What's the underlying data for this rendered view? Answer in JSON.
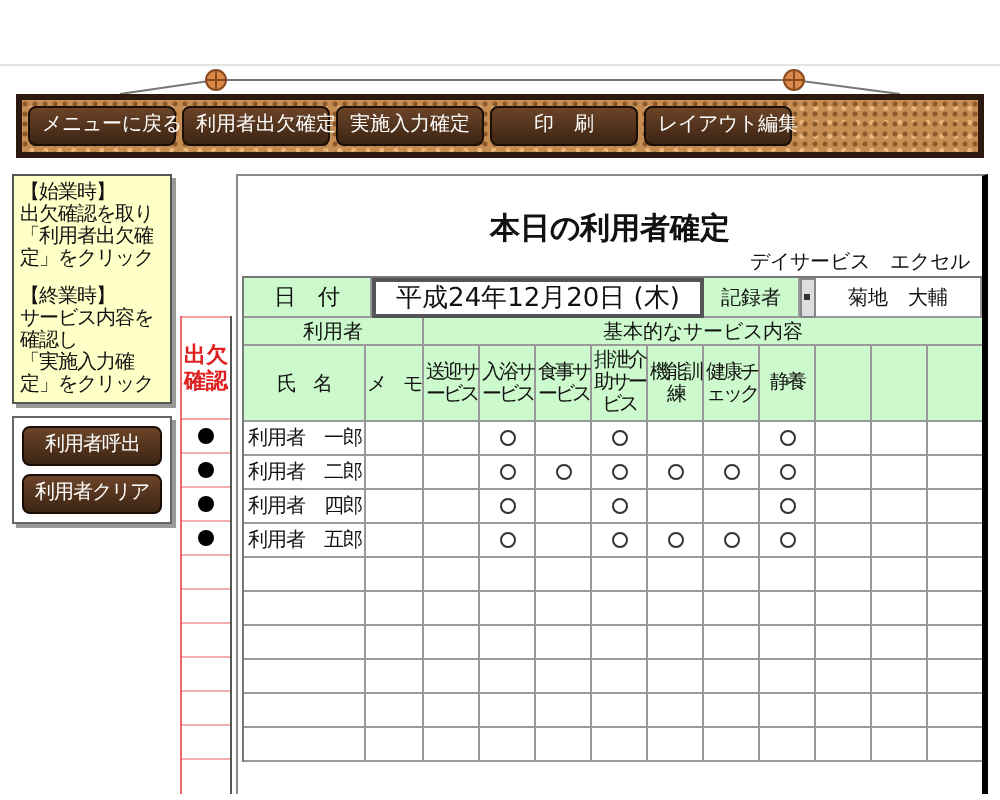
{
  "toolbar": {
    "buttons": [
      "メニューに戻る",
      "利用者出欠確定",
      "実施入力確定",
      "印　刷",
      "レイアウト編集"
    ]
  },
  "notes": [
    {
      "heading": "【始業時】",
      "lines": [
        "出欠確認を取り",
        "「利用者出欠確定」をクリック"
      ]
    },
    {
      "heading": "【終業時】",
      "lines": [
        "サービス内容を確認し",
        "「実施入力確定」をクリック"
      ]
    }
  ],
  "actions": [
    "利用者呼出",
    "利用者クリア"
  ],
  "attendance": {
    "header": [
      "出欠",
      "確認"
    ]
  },
  "sheet": {
    "title": "本日の利用者確定",
    "organization": "デイサービス　エクセル",
    "date_label": "日　付",
    "date": "平成24年12月20日 (木)",
    "recorder_label": "記録者",
    "recorder": "菊地　大輔",
    "user_header": "利用者",
    "service_header": "基本的なサービス内容",
    "name_header": "氏　名",
    "memo_header": "メ　モ",
    "service_columns": [
      "送迎サービス",
      "入浴サービス",
      "食事サービス",
      "排泄介助サービス",
      "機能訓練",
      "健康チェック",
      "静養"
    ],
    "rows": [
      {
        "name": "利用者　一郎",
        "present": true,
        "services": [
          false,
          true,
          false,
          true,
          false,
          false,
          true
        ]
      },
      {
        "name": "利用者　二郎",
        "present": true,
        "services": [
          false,
          true,
          true,
          true,
          true,
          true,
          true
        ]
      },
      {
        "name": "利用者　四郎",
        "present": true,
        "services": [
          false,
          true,
          false,
          true,
          false,
          false,
          true
        ]
      },
      {
        "name": "利用者　五郎",
        "present": true,
        "services": [
          false,
          true,
          false,
          true,
          true,
          true,
          true
        ]
      }
    ]
  }
}
